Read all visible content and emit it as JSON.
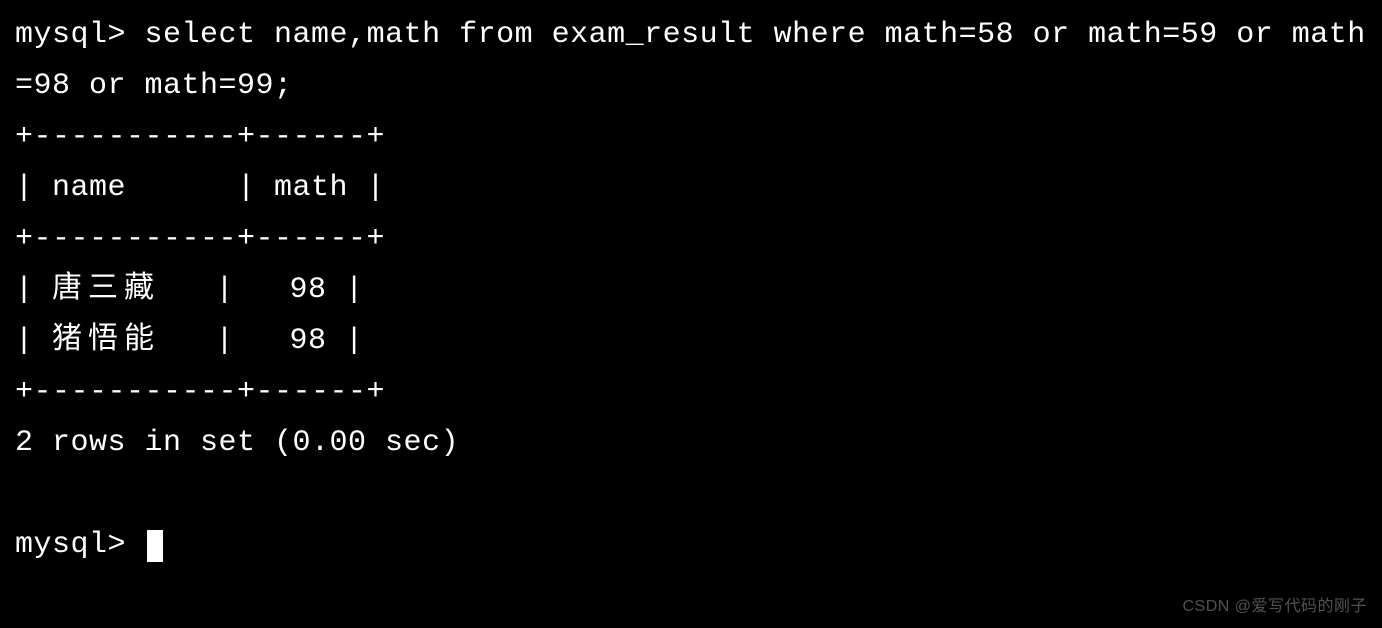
{
  "terminal": {
    "prompt": "mysql> ",
    "query": "select name,math from exam_result where math=58 or math=59 or math=98 or math=99;",
    "table": {
      "border_top": "+-----------+------+",
      "header_row": "| name      | math |",
      "border_mid": "+-----------+------+",
      "rows": [
        {
          "name": "唐三藏",
          "math": "98"
        },
        {
          "name": "猪悟能",
          "math": "98"
        }
      ],
      "border_bottom": "+-----------+------+"
    },
    "status": "2 rows in set (0.00 sec)",
    "empty_line": " ",
    "next_prompt": "mysql> "
  },
  "watermark": "CSDN @爱写代码的刚子",
  "chart_data": {
    "type": "table",
    "title": "exam_result query output",
    "columns": [
      "name",
      "math"
    ],
    "rows": [
      [
        "唐三藏",
        98
      ],
      [
        "猪悟能",
        98
      ]
    ]
  }
}
